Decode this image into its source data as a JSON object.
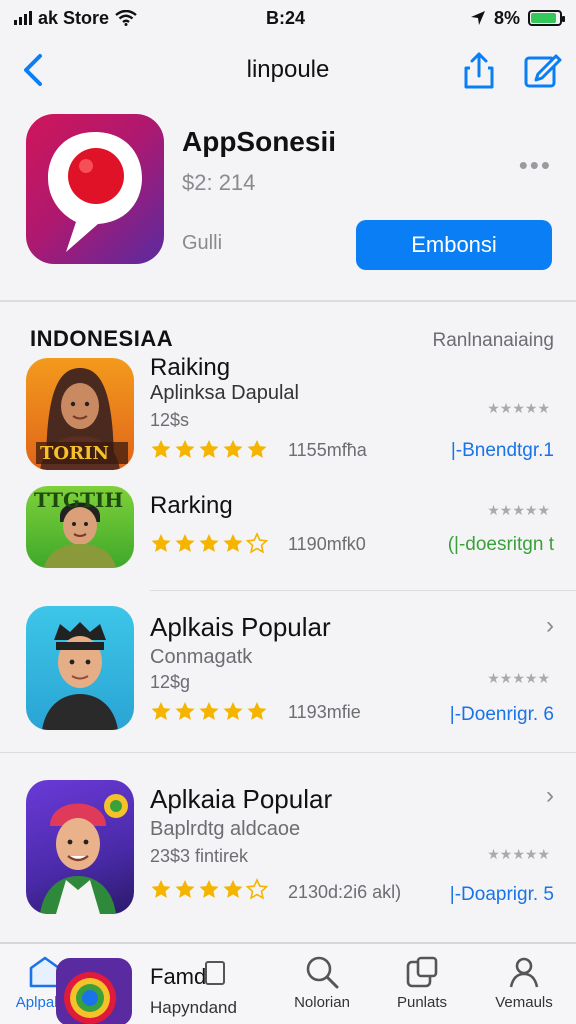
{
  "status_bar": {
    "carrier": "ak Store",
    "time": "B:24",
    "battery_text": "8%",
    "battery_level": 0.9
  },
  "nav": {
    "title": "linpoule"
  },
  "app": {
    "name": "AppSonesii",
    "price": "$2: 214",
    "developer": "Gulli",
    "get_label": "Embonsi",
    "more_label": "•••"
  },
  "section": {
    "title": "INDONESIAA",
    "link": "Ranlnanaiaing"
  },
  "rows": [
    {
      "title": "Raiking",
      "subtitle": "Aplinksa Dapulal",
      "meta": "12$s",
      "rating": 5,
      "size": "1155mfħa",
      "link": "|-Bnendtgr.1",
      "icon_text": "TORIN",
      "icon": "woman-avatar-icon"
    },
    {
      "title": "Rarking",
      "subtitle": "",
      "meta": "",
      "rating": 4,
      "size": "1190mfk0",
      "link": "(|-doesritgn t",
      "icon_text": "TTGTIH",
      "icon": "man-avatar-icon"
    },
    {
      "title": "Aplkais Popular",
      "subtitle": "Conmagatk",
      "meta": "12$g",
      "rating": 5,
      "size": "1193mfie",
      "link": "|-Doenrigr. 6",
      "icon": "man-cap-avatar-icon"
    },
    {
      "title": "Aplkaia Popular",
      "subtitle": "Baplrdtg aldcaoe",
      "meta": "23$3 fintirek",
      "rating": 4,
      "size": "2130d:2i6 akl)",
      "link": "|-Doaprigr. 5",
      "icon": "man-beanie-avatar-icon"
    }
  ],
  "tab_bar": {
    "tabs": [
      {
        "label": "Aplpaldo",
        "icon": "today-icon"
      },
      {
        "label": "Nolorian",
        "icon": "search-icon"
      },
      {
        "label": "Punlats",
        "icon": "apps-icon"
      },
      {
        "label": "Vemauls",
        "icon": "account-icon"
      }
    ],
    "featured": {
      "title": "Famd",
      "subtitle": "Hapyndand"
    }
  },
  "colors": {
    "accent": "#0a7ef5",
    "link": "#1a73e8",
    "link_green": "#3aa13a",
    "star": "#f5b400",
    "battery": "#34c759"
  }
}
